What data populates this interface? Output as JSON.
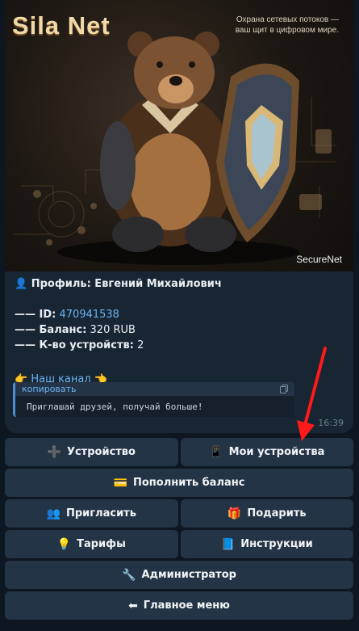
{
  "banner": {
    "brand": "Sila Net",
    "tagline_line1": "Охрана сетевых потоков —",
    "tagline_line2": "ваш щит в цифровом мире.",
    "watermark": "SecureNet"
  },
  "message": {
    "profile_icon": "👤",
    "profile_label": "Профиль: Евгений Михайлович",
    "id_prefix": "—— ID:",
    "id_value": "470941538",
    "balance_prefix": "—— Баланс:",
    "balance_value": "320 RUB",
    "devices_prefix": "—— К-во устройств:",
    "devices_value": "2",
    "channel_left_icon": "👉",
    "channel_link": "Наш канал",
    "channel_right_icon": "👈",
    "quote_label": "копировать",
    "quote_text": "Приглашай друзей, получай больше!",
    "time": "16:39"
  },
  "keyboard": {
    "add_device": {
      "icon": "➕",
      "label": "Устройство"
    },
    "my_devices": {
      "icon": "📱",
      "label": "Мои устройства"
    },
    "top_up": {
      "icon": "💳",
      "label": "Пополнить баланс"
    },
    "invite": {
      "icon": "👥",
      "label": "Пригласить"
    },
    "gift": {
      "icon": "🎁",
      "label": "Подарить"
    },
    "tariffs": {
      "icon": "💡",
      "label": "Тарифы"
    },
    "instructions": {
      "icon": "📘",
      "label": "Инструкции"
    },
    "admin": {
      "icon": "🔧",
      "label": "Администратор"
    },
    "main_menu": {
      "icon": "⬅",
      "label": "Главное меню"
    }
  },
  "colors": {
    "accent": "#6ab3f3",
    "annotation_arrow": "#ff1a1a"
  }
}
